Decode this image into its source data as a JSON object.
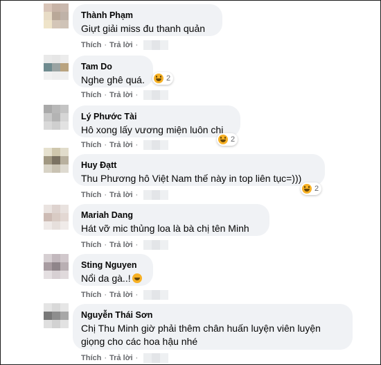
{
  "comments": [
    {
      "author": "Thành Phạm",
      "text": "Giựt giải miss đu thanh quản",
      "like": "Thích",
      "reply": "Trả lời",
      "avatar": [
        "#d9c5b8",
        "#c7b3a6",
        "#c9b8ae",
        "#e8dcc6",
        "#b9a898",
        "#bfb2a8",
        "#efe4c9",
        "#d4c6b8",
        "#cfc3b7"
      ]
    },
    {
      "author": "Tam Do",
      "text": "Nghe ghê quá.",
      "reaction_count": "2",
      "like": "Thích",
      "reply": "Trả lời",
      "avatar": [
        "#e9e9e9",
        "#e6e6e6",
        "#ececec",
        "#6f8b8f",
        "#9aa3a2",
        "#b9a37f",
        "#f1f1f1",
        "#eeeeee",
        "#efefef"
      ]
    },
    {
      "author": "Lý Phước Tài",
      "text": "Hô xong lấy vương miện luôn chị",
      "reaction_count": "2",
      "like": "Thích",
      "reply": "Trả lời",
      "avatar": [
        "#a9a9a9",
        "#b8b8b8",
        "#c4c4c4",
        "#c9c9c9",
        "#b3b3b3",
        "#d6d6d6",
        "#d9d9d9",
        "#cfcfcf",
        "#e2e2e2"
      ]
    },
    {
      "author": "Huy Đạtt",
      "text": "Thu Phương hô Việt Nam thế này in top liên tục=)))",
      "reaction_count": "2",
      "like": "Thích",
      "reply": "Trả lời",
      "avatar": [
        "#e6e1cf",
        "#cfc7ad",
        "#e1dccb",
        "#a19882",
        "#7b7262",
        "#b8b09e",
        "#d8d3c6",
        "#c9c2b2",
        "#dedad0"
      ]
    },
    {
      "author": "Mariah Dang",
      "text": "Hát vỡ mic thủng loa là bà chị tên Minh",
      "like": "Thích",
      "reply": "Trả lời",
      "avatar": [
        "#eae3e0",
        "#ded3cf",
        "#e9e2df",
        "#cdbbb4",
        "#d9cbc4",
        "#e3d8d3",
        "#efeae8",
        "#e6dfdc",
        "#f0ebe9"
      ]
    },
    {
      "author": "Sting Nguyen",
      "text": "Nổi da gà..!",
      "like": "Thích",
      "reply": "Trả lời",
      "avatar": [
        "#d6cfd2",
        "#c2b8bd",
        "#d1c8cc",
        "#a89ca1",
        "#8f858a",
        "#b9afb3",
        "#e4dfe1",
        "#d7d0d3",
        "#e0dadc"
      ]
    },
    {
      "author": "Nguyễn Thái Sơn",
      "text": "Chị Thu Minh giờ phải thêm chân huấn luyện viên luyện giọng cho các hoa hậu nhé",
      "like": "Thích",
      "reply": "Trả lời",
      "avatar": [
        "#e4e4e4",
        "#d9d9d9",
        "#e6e6e6",
        "#787878",
        "#8e8e8e",
        "#a7a7a7",
        "#dfdfdf",
        "#d2d2d2",
        "#e2e2e2"
      ]
    }
  ],
  "colors": {
    "bubble": "#f0f2f5",
    "meta": "#65676b",
    "reaction": "#f7b125"
  },
  "icons": {
    "reaction": "haha-reaction-icon"
  }
}
